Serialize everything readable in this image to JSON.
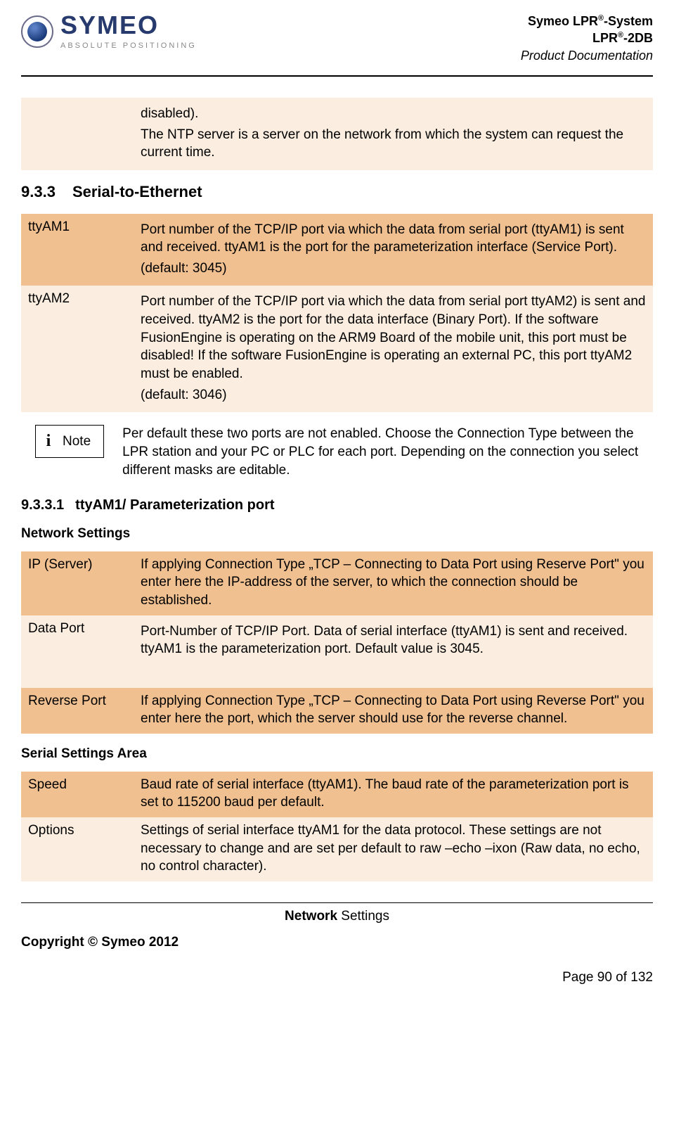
{
  "header": {
    "brand_name": "SYMEO",
    "brand_tag": "ABSOLUTE POSITIONING",
    "title_line1_prefix": "Symeo LPR",
    "title_line1_suffix": "-System",
    "title_line2_prefix": "LPR",
    "title_line2_suffix": "-2DB",
    "title_line3": "Product Documentation",
    "reg": "®"
  },
  "intro_row": {
    "label": "",
    "p1": "disabled).",
    "p2": "The NTP server is a server on the network from which the system can request the current time."
  },
  "section_933": {
    "num": "9.3.3",
    "title": "Serial-to-Ethernet",
    "rows": [
      {
        "label": "ttyAM1",
        "p1": "Port number of the TCP/IP port via which the data from serial port (ttyAM1) is sent and received. ttyAM1 is the port for the parameterization interface (Service Port).",
        "p2": "(default: 3045)"
      },
      {
        "label": "ttyAM2",
        "p1": "Port number of the TCP/IP port via which the data from serial port ttyAM2) is sent and received. ttyAM2 is the port for the data interface (Binary Port). If the software FusionEngine is operating on the ARM9 Board of the mobile unit, this port must be disabled! If the software FusionEngine is operating an external PC, this port ttyAM2 must be enabled.",
        "p2": "(default: 3046)"
      }
    ]
  },
  "note": {
    "label": "Note",
    "text": "Per default these two ports are not enabled. Choose the Connection Type between the LPR station and your PC or PLC for each port. Depending on the connection you select different masks are editable."
  },
  "section_9331": {
    "num": "9.3.3.1",
    "title": "ttyAM1/ Parameterization port"
  },
  "network_settings": {
    "heading": "Network Settings",
    "rows": [
      {
        "label": "IP (Server)",
        "desc": "If applying Connection Type „TCP – Connecting to Data Port using Reserve Port\" you enter here the IP-address of the server, to which the connection should be established."
      },
      {
        "label": "Data Port",
        "desc": "Port-Number of TCP/IP Port. Data of serial interface (ttyAM1) is sent and received. ttyAM1 is the parameterization port. Default value is 3045."
      },
      {
        "label": "Reverse Port",
        "desc": "If applying Connection Type „TCP – Connecting to Data Port using Reverse Port\" you enter here the port, which the server should use for the reverse channel."
      }
    ]
  },
  "serial_settings": {
    "heading": "Serial Settings Area",
    "rows": [
      {
        "label": "Speed",
        "desc": "Baud rate of serial interface (ttyAM1). The baud rate of the parameterization port is set to 115200 baud per default."
      },
      {
        "label": "Options",
        "desc": "Settings of serial interface ttyAM1 for the data protocol. These settings are not necessary to change and are set per default to raw –echo –ixon (Raw data, no echo, no control character)."
      }
    ]
  },
  "footer": {
    "section_bold": "Network",
    "section_rest": " Settings",
    "copyright": "Copyright © Symeo 2012",
    "page": "Page 90 of 132"
  }
}
